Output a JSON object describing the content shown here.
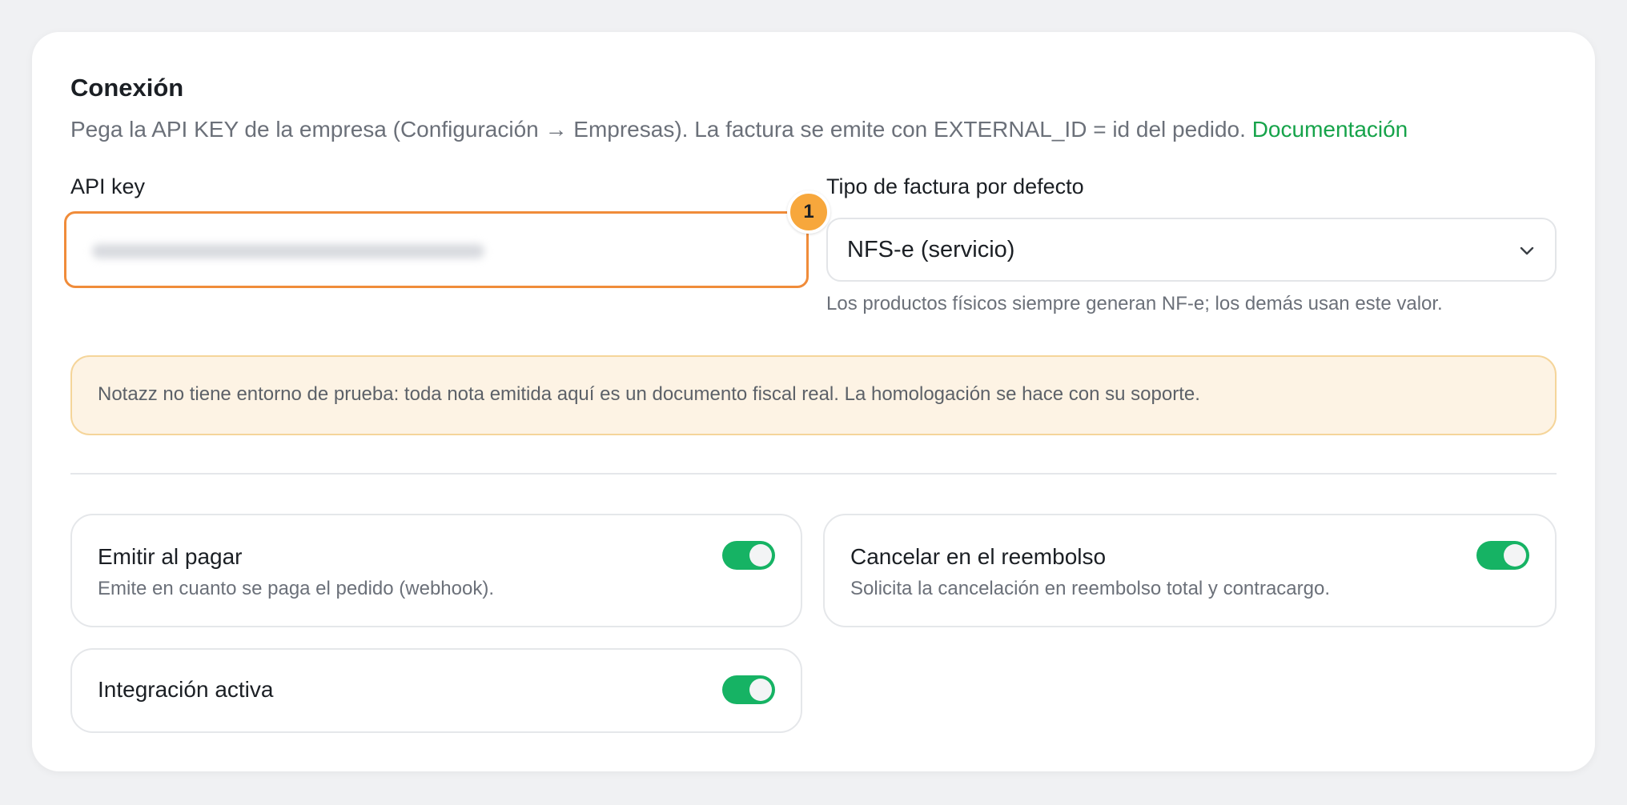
{
  "connection": {
    "title": "Conexión",
    "description": "Pega la API KEY de la empresa (Configuración → Empresas). La factura se emite con EXTERNAL_ID = id del pedido.",
    "doc_link": "Documentación"
  },
  "api_key": {
    "label": "API key",
    "value": "",
    "masked": true
  },
  "step_badge": "1",
  "invoice_type": {
    "label": "Tipo de factura por defecto",
    "selected": "NFS-e (servicio)",
    "hint": "Los productos físicos siempre generan NF-e; los demás usan este valor."
  },
  "warning": {
    "text": "Notazz no tiene entorno de prueba: toda nota emitida aquí es un documento fiscal real. La homologación se hace con su soporte."
  },
  "toggles": [
    {
      "title": "Emitir al pagar",
      "description": "Emite en cuanto se paga el pedido (webhook).",
      "on": true
    },
    {
      "title": "Cancelar en el reembolso",
      "description": "Solicita la cancelación en reembolso total y contracargo.",
      "on": true
    },
    {
      "title": "Integración activa",
      "description": "",
      "on": true
    }
  ],
  "colors": {
    "accent_green": "#16b364",
    "link_green": "#16a34a",
    "focus_orange": "#f08c3a",
    "badge_orange": "#f7a73c",
    "warning_bg": "#fdf3e4"
  }
}
